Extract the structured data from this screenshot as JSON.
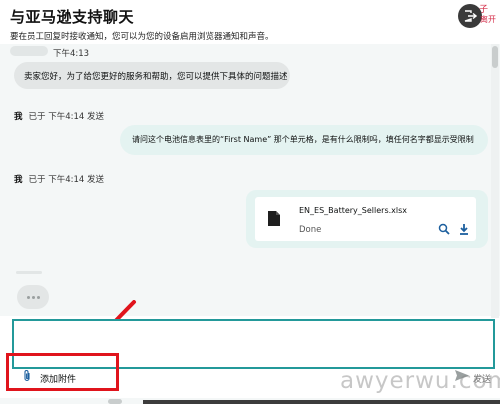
{
  "header": {
    "title": "与亚马逊支持聊天",
    "subtitle": "要在员工回复时接收通知，您可以为您的设备启用浏览器通知和声音。",
    "exit_label": "离开",
    "exit_corner": "子"
  },
  "messages": [
    {
      "time": "下午4:13",
      "text": "卖家您好，为了给您更好的服务和帮助，您可以提供下具体的问题描述"
    },
    {
      "sender": "我",
      "meta": "已于 下午4:14 发送",
      "text": "请问这个电池信息表里的“First Name” 那个单元格，是有什么限制吗，填任何名字都显示受限制"
    },
    {
      "sender": "我",
      "meta": "已于 下午4:14 发送"
    }
  ],
  "attachment": {
    "file_name": "EN_ES_Battery_Sellers.xlsx",
    "status": "Done"
  },
  "composer": {
    "attach_label": "添加附件",
    "send_label": "发送"
  },
  "watermark": "awyerwu.com",
  "colors": {
    "accent": "#23999a",
    "highlight_red": "#e0141c",
    "sent_bubble": "#e4f3f1",
    "received_bubble": "#e3e6e6"
  }
}
